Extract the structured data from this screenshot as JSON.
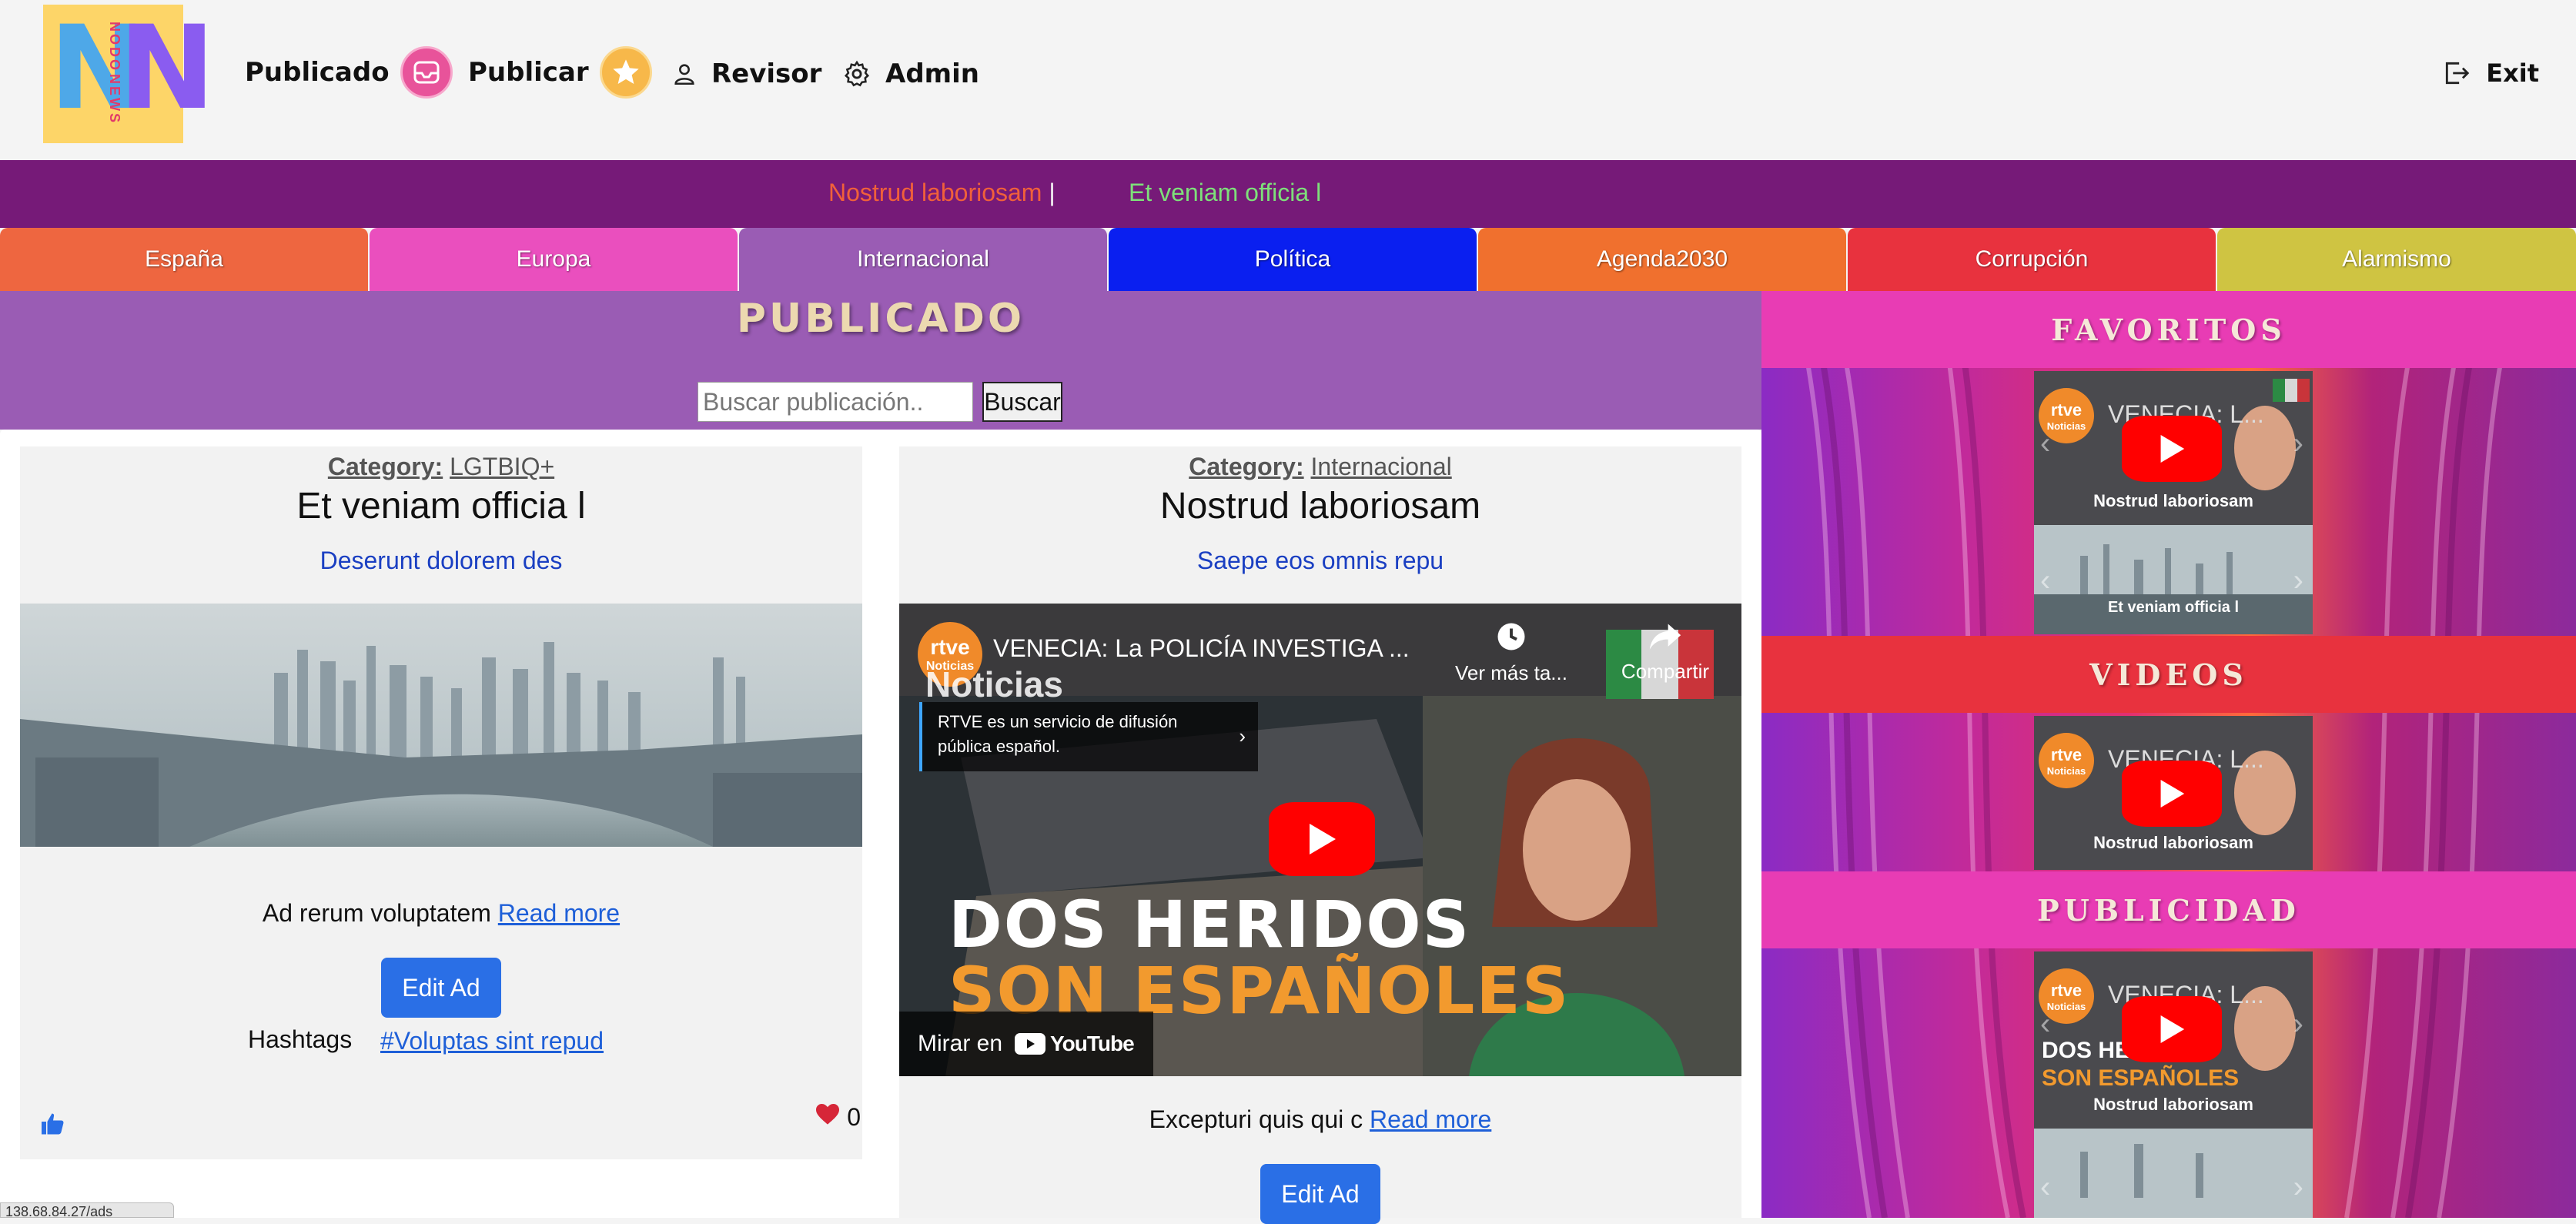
{
  "header": {
    "logo_letters": [
      "N",
      "N"
    ],
    "logo_vertical_text": [
      "NODO",
      "NEWS"
    ],
    "nav": [
      {
        "label": "Publicado",
        "icon": "inbox-icon",
        "badge_color": "#e8539a"
      },
      {
        "label": "Publicar",
        "icon": "star-icon",
        "badge_color": "#f7b84a"
      },
      {
        "label": "Revisor",
        "icon": "person-icon"
      },
      {
        "label": "Admin",
        "icon": "gear-icon"
      }
    ],
    "exit_label": "Exit"
  },
  "ticker": {
    "items": [
      {
        "text": "Nostrud laboriosam",
        "separator": "|",
        "color": "#f0603a"
      },
      {
        "text": "Et veniam officia l",
        "color": "#7ee07a"
      }
    ]
  },
  "categories": [
    {
      "label": "España",
      "color": "#ee6640"
    },
    {
      "label": "Europa",
      "color": "#ea4fbe"
    },
    {
      "label": "Internacional",
      "color": "#9a5cb4"
    },
    {
      "label": "Política",
      "color": "#0a1ff0"
    },
    {
      "label": "Agenda2030",
      "color": "#f0702e"
    },
    {
      "label": "Corrupción",
      "color": "#e8323e"
    },
    {
      "label": "Alarmismo",
      "color": "#cfc442"
    }
  ],
  "main": {
    "title": "PUBLICADO",
    "search": {
      "placeholder": "Buscar publicación..",
      "button": "Buscar"
    },
    "posts": [
      {
        "category_label": "Category:",
        "category": "LGTBIQ+",
        "title": "Et veniam officia l",
        "subtitle": "Deserunt dolorem des",
        "media": "city-skyline-image",
        "excerpt": "Ad rerum voluptatem",
        "read_more": "Read more",
        "edit": "Edit Ad",
        "hashtags_label": "Hashtags",
        "hashtag": "#Voluptas sint repud",
        "likes": "0"
      },
      {
        "category_label": "Category:",
        "category": "Internacional",
        "title": "Nostrud laboriosam",
        "subtitle": "Saepe eos omnis repu",
        "video": {
          "channel": "rtve",
          "channel_sub": "Noticias",
          "title": "VENECIA: La POLICÍA INVESTIGA ...",
          "overlay_word": "Noticias",
          "info": "RTVE es un servicio de difusión pública español.",
          "watch_later": "Ver más ta...",
          "share": "Compartir",
          "headline1": "DOS HERIDOS",
          "headline2": "SON ESPAÑOLES",
          "watch_on": "Mirar en",
          "platform": "YouTube"
        },
        "excerpt": "Excepturi quis qui c",
        "read_more": "Read more",
        "edit": "Edit Ad"
      }
    ]
  },
  "sidebar": {
    "sections": [
      {
        "title": "FAVORITOS",
        "color": "#e83cb4",
        "items": [
          "Nostrud laboriosam",
          "Et veniam officia l"
        ]
      },
      {
        "title": "VIDEOS",
        "color": "#e8323e",
        "items": [
          "Nostrud laboriosam"
        ]
      },
      {
        "title": "PUBLICIDAD",
        "color": "#e83cb4",
        "items": [
          "Nostrud laboriosam"
        ]
      }
    ],
    "video_card": {
      "channel": "rtve",
      "channel_sub": "Noticias",
      "title": "VENECIA: L...",
      "partial_channel": "rtve Not",
      "partial_overlay": "DOS HE",
      "partial_overlay2": "SON ESPAÑOLES",
      "partial_overlay3": "ON"
    }
  },
  "status_bar": {
    "url": "138.68.84.27/ads"
  }
}
